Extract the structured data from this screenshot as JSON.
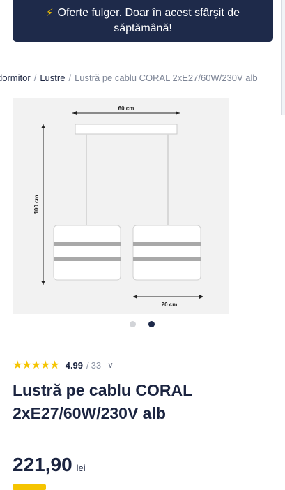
{
  "promo": {
    "icon": "lightning-icon",
    "text": "Oferte fulger. Doar în acest sfârșit de săptămână!",
    "background": "#1e2a4a",
    "icon_color": "#f5c400"
  },
  "breadcrumb": {
    "items": [
      "dormitor",
      "Lustre"
    ],
    "current": "Lustră pe cablu CORAL 2xE27/60W/230V alb"
  },
  "gallery": {
    "dimension_width": "60 cm",
    "dimension_height": "100 cm",
    "dimension_shade": "20 cm",
    "slide_count": 2,
    "active_slide": 2
  },
  "rating": {
    "stars": "★★★★★",
    "score": "4.99",
    "separator": "/",
    "count": "33",
    "star_color": "#f5c400"
  },
  "product": {
    "title": "Lustră pe cablu CORAL 2xE27/60W/230V alb",
    "price": "221,90",
    "currency": "lei"
  }
}
